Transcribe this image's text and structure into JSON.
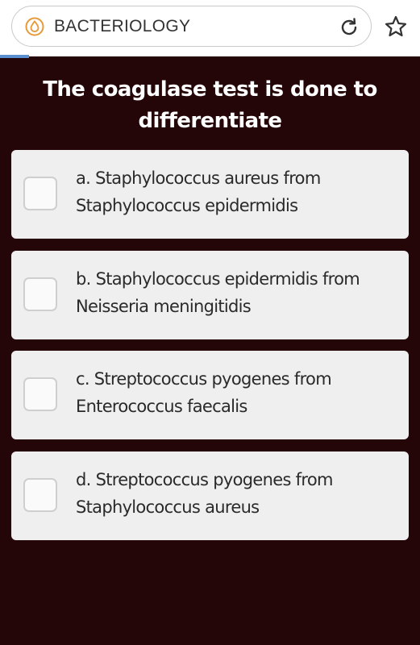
{
  "browser": {
    "url_text": "BACTERIOLOGY",
    "site_icon": "drop-in-circle-icon",
    "reload_icon": "reload-icon",
    "bookmark_icon": "star-icon",
    "accent_color": "#e69a3a"
  },
  "quiz": {
    "question": "The coagulase test is done to differentiate",
    "options": [
      {
        "label": "a. Staphylococcus aureus from Staphylococcus epidermidis"
      },
      {
        "label": "b. Staphylococcus epidermidis from Neisseria meningitidis"
      },
      {
        "label": "c. Streptococcus pyogenes from Enterococcus faecalis"
      },
      {
        "label": "d. Streptococcus pyogenes from Staphylococcus aureus"
      }
    ]
  },
  "colors": {
    "background": "#250608",
    "option_bg": "#efefef",
    "question_text": "#ffffff"
  }
}
